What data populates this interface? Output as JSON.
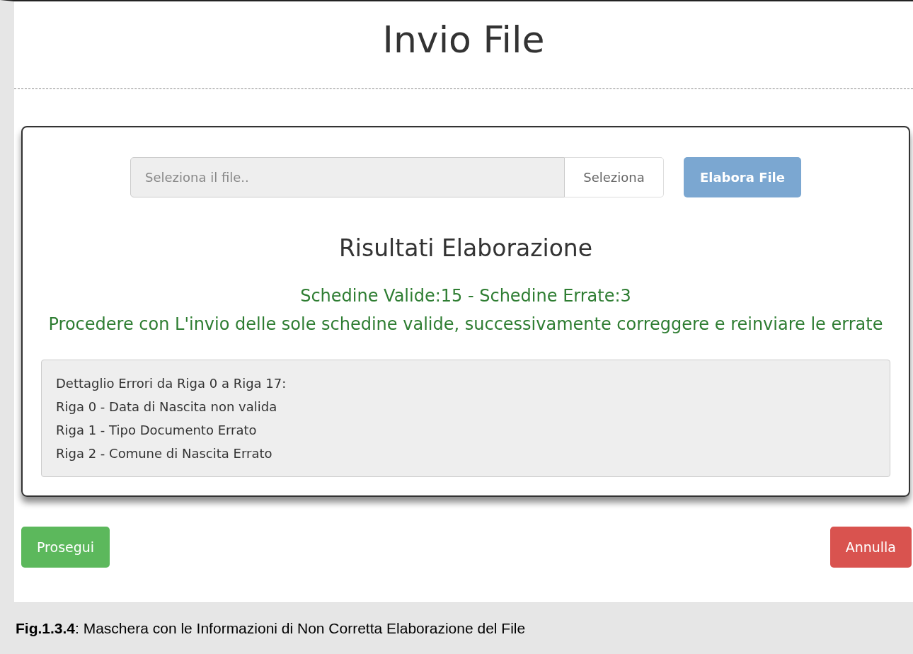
{
  "page": {
    "title": "Invio File"
  },
  "upload": {
    "placeholder": "Seleziona il file..",
    "browse_label": "Seleziona",
    "process_button": {
      "label": "Elabora File",
      "disabled": true
    }
  },
  "results": {
    "heading": "Risultati Elaborazione",
    "summary": "Schedine Valide:15 - Schedine Errate:3",
    "message": "Procedere con L'invio delle sole schedine valide, successivamente correggere e reinviare le errate"
  },
  "error_details": [
    "Dettaglio Errori da Riga 0 a Riga 17:",
    "Riga 0 - Data di Nascita non valida",
    "Riga 1 - Tipo Documento Errato",
    "Riga 2 - Comune di Nascita Errato"
  ],
  "buttons": {
    "proceed": "Prosegui",
    "cancel": "Annulla"
  },
  "caption": "**Fig.1.3.4**: Maschera con le Informazioni di Non Corretta Elaborazione del File"
}
